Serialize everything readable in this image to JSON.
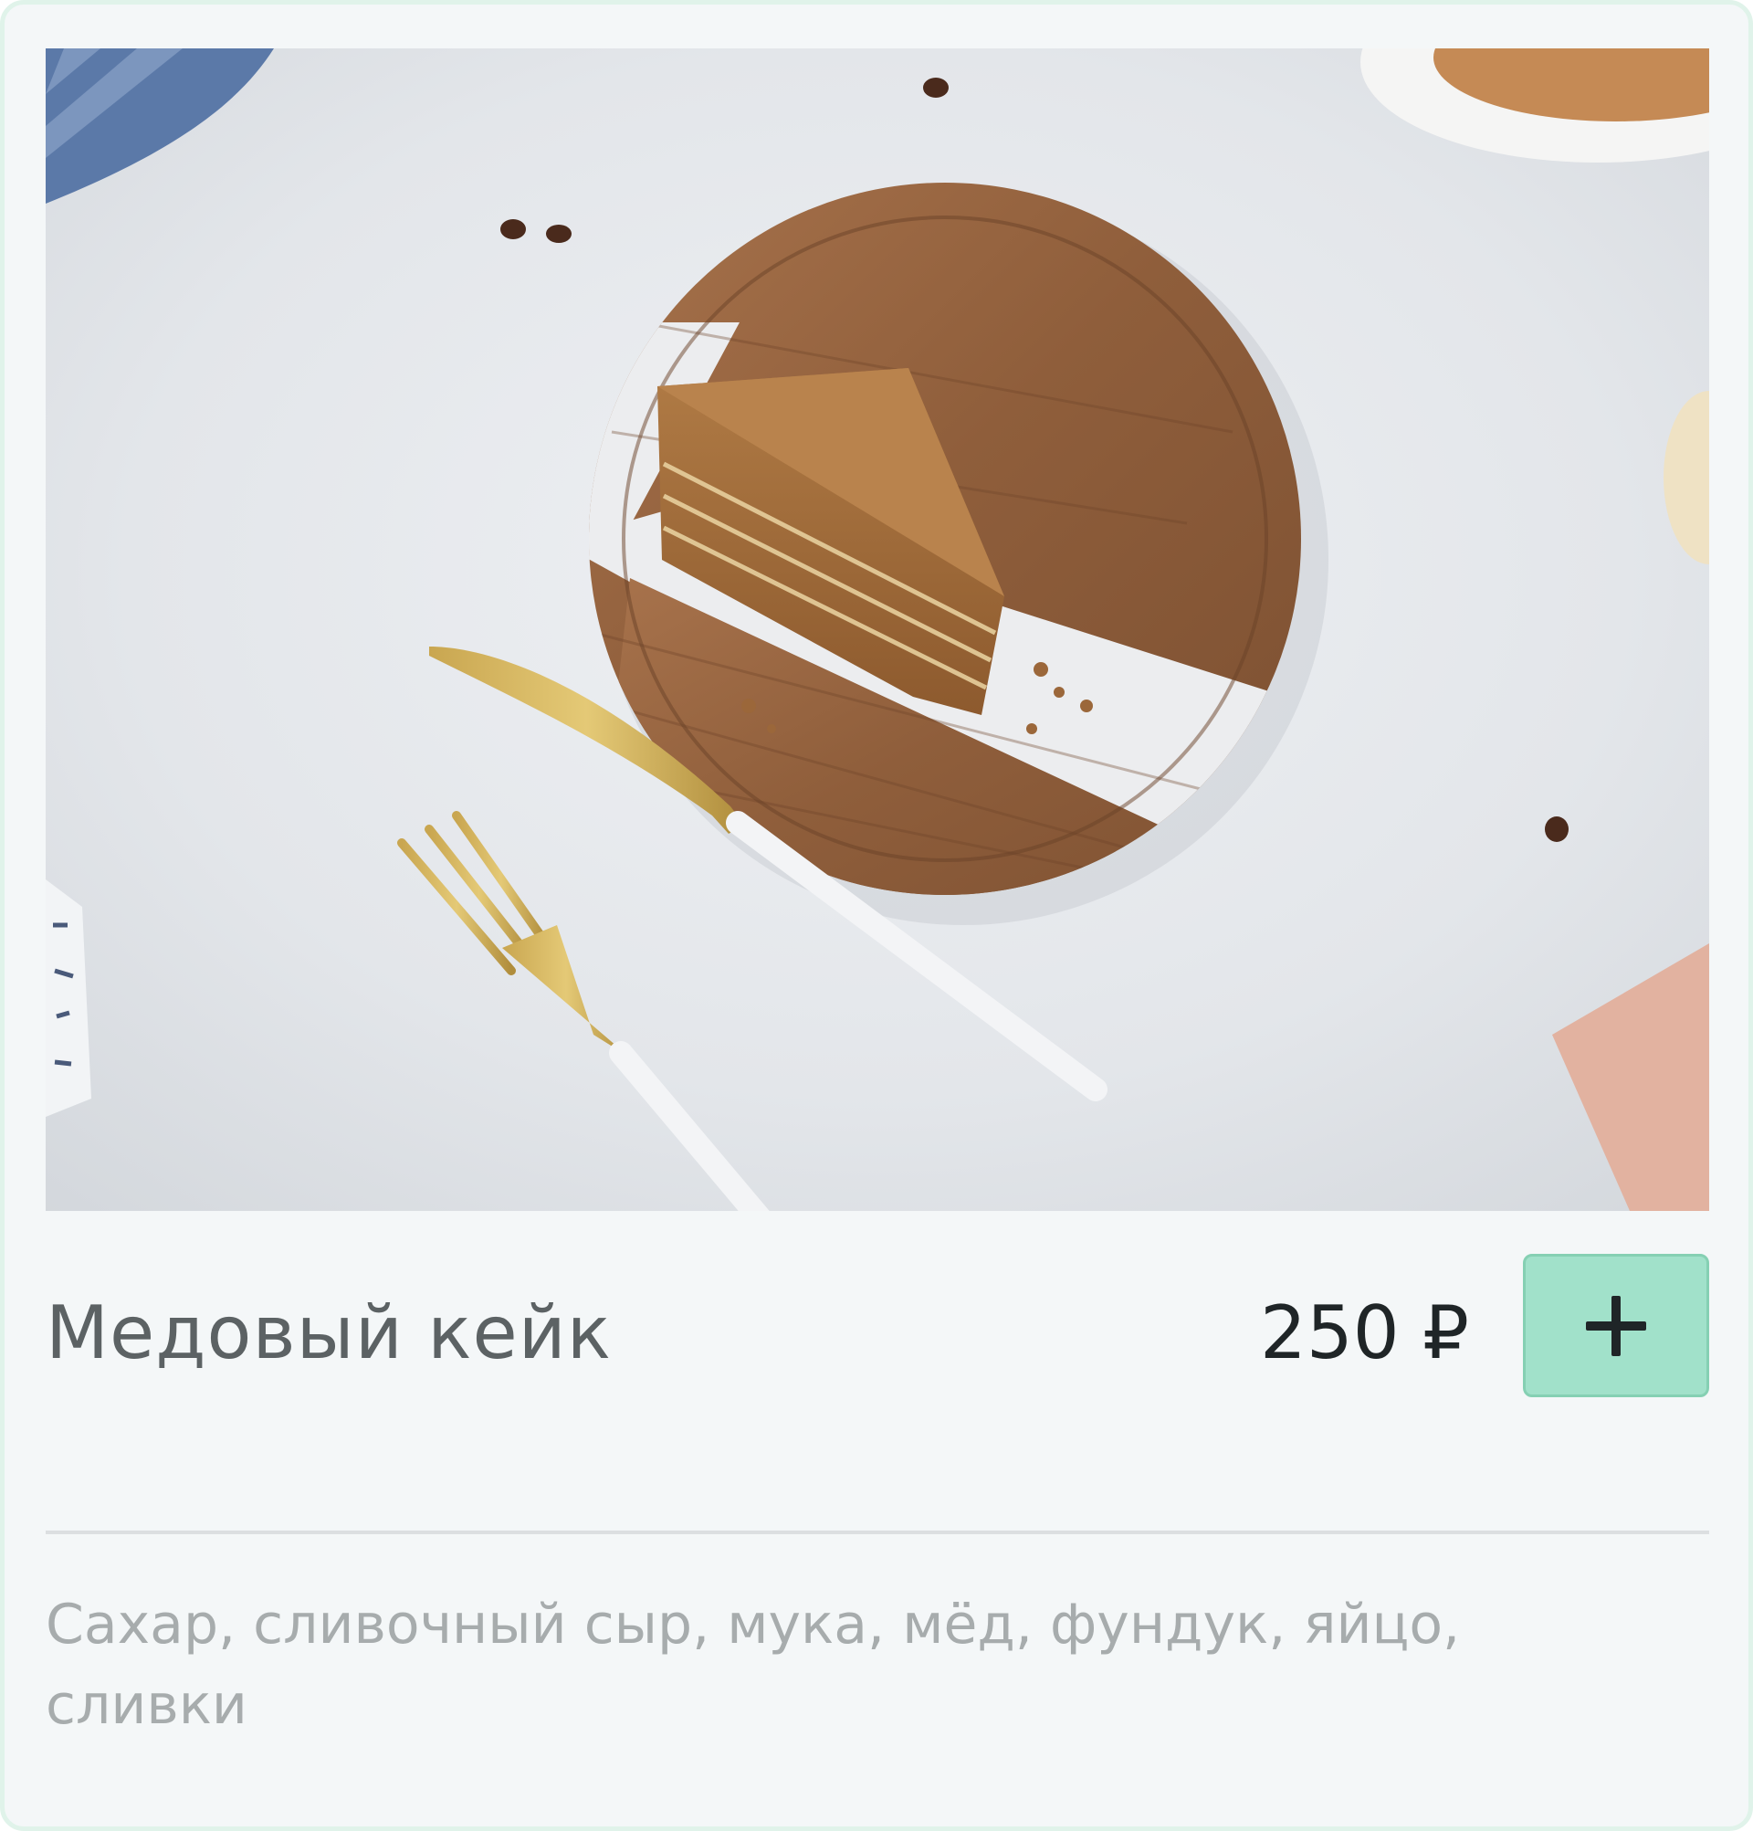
{
  "product": {
    "image_alt": "Медовый кейк",
    "title": "Медовый кейк",
    "price": "250 ₽",
    "add_button_icon": "plus-icon",
    "ingredients": "Сахар, сливочный сыр, мука, мёд, фундук, яйцо, сливки"
  },
  "colors": {
    "card_background": "#f4f7f8",
    "card_border": "#e0f3ea",
    "accent_button": "#a1e1ca",
    "accent_button_border": "#85d0b3",
    "title_text": "#5c6264",
    "price_text": "#1f2527",
    "ingredients_text": "#a7acad",
    "divider": "#dcdfe1"
  }
}
